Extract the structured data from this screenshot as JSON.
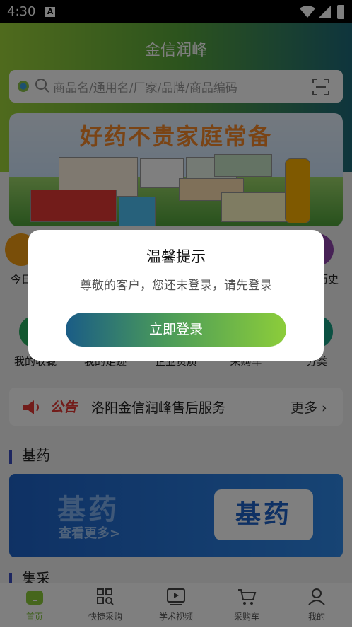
{
  "status_bar": {
    "time": "4:30"
  },
  "header": {
    "title": "金信润峰"
  },
  "search": {
    "placeholder": "商品名/通用名/厂家/品牌/商品编码"
  },
  "banner": {
    "slogan": "好药不贵家庭常备"
  },
  "quick_menu": [
    {
      "label": "今日",
      "color": "#f39c12"
    },
    {
      "label": "",
      "color": "#e74c3c"
    },
    {
      "label": "",
      "color": "#3498db"
    },
    {
      "label": "",
      "color": "#1abc9c"
    },
    {
      "label": "历史",
      "color": "#8e44ad"
    },
    {
      "label": "我的收藏",
      "color": "#27ae60"
    },
    {
      "label": "我的足迹",
      "color": "#e67e22"
    },
    {
      "label": "企业资质",
      "color": "#2980b9"
    },
    {
      "label": "采购车",
      "color": "#c0392b"
    },
    {
      "label": "分类",
      "color": "#16a085"
    }
  ],
  "notice": {
    "tag": "公告",
    "text": "洛阳金信润峰售后服务",
    "more": "更多 ›"
  },
  "sections": {
    "jiyao": {
      "title": "基药",
      "banner_big": "基药",
      "banner_sub": "查看更多>",
      "banner_card": "基药"
    },
    "jicai": {
      "title": "集采"
    }
  },
  "tabbar": [
    {
      "label": "首页",
      "icon": "home-icon"
    },
    {
      "label": "快捷采购",
      "icon": "grid-search-icon"
    },
    {
      "label": "学术视频",
      "icon": "video-icon"
    },
    {
      "label": "采购车",
      "icon": "cart-icon"
    },
    {
      "label": "我的",
      "icon": "user-icon"
    }
  ],
  "dialog": {
    "title": "温馨提示",
    "message": "尊敬的客户，您还未登录，请先登录",
    "button": "立即登录"
  },
  "colors": {
    "brand_green": "#8ccd3a",
    "brand_teal": "#1a5c86",
    "notice_red": "#e53935",
    "section_bar": "#3b4cc0"
  }
}
